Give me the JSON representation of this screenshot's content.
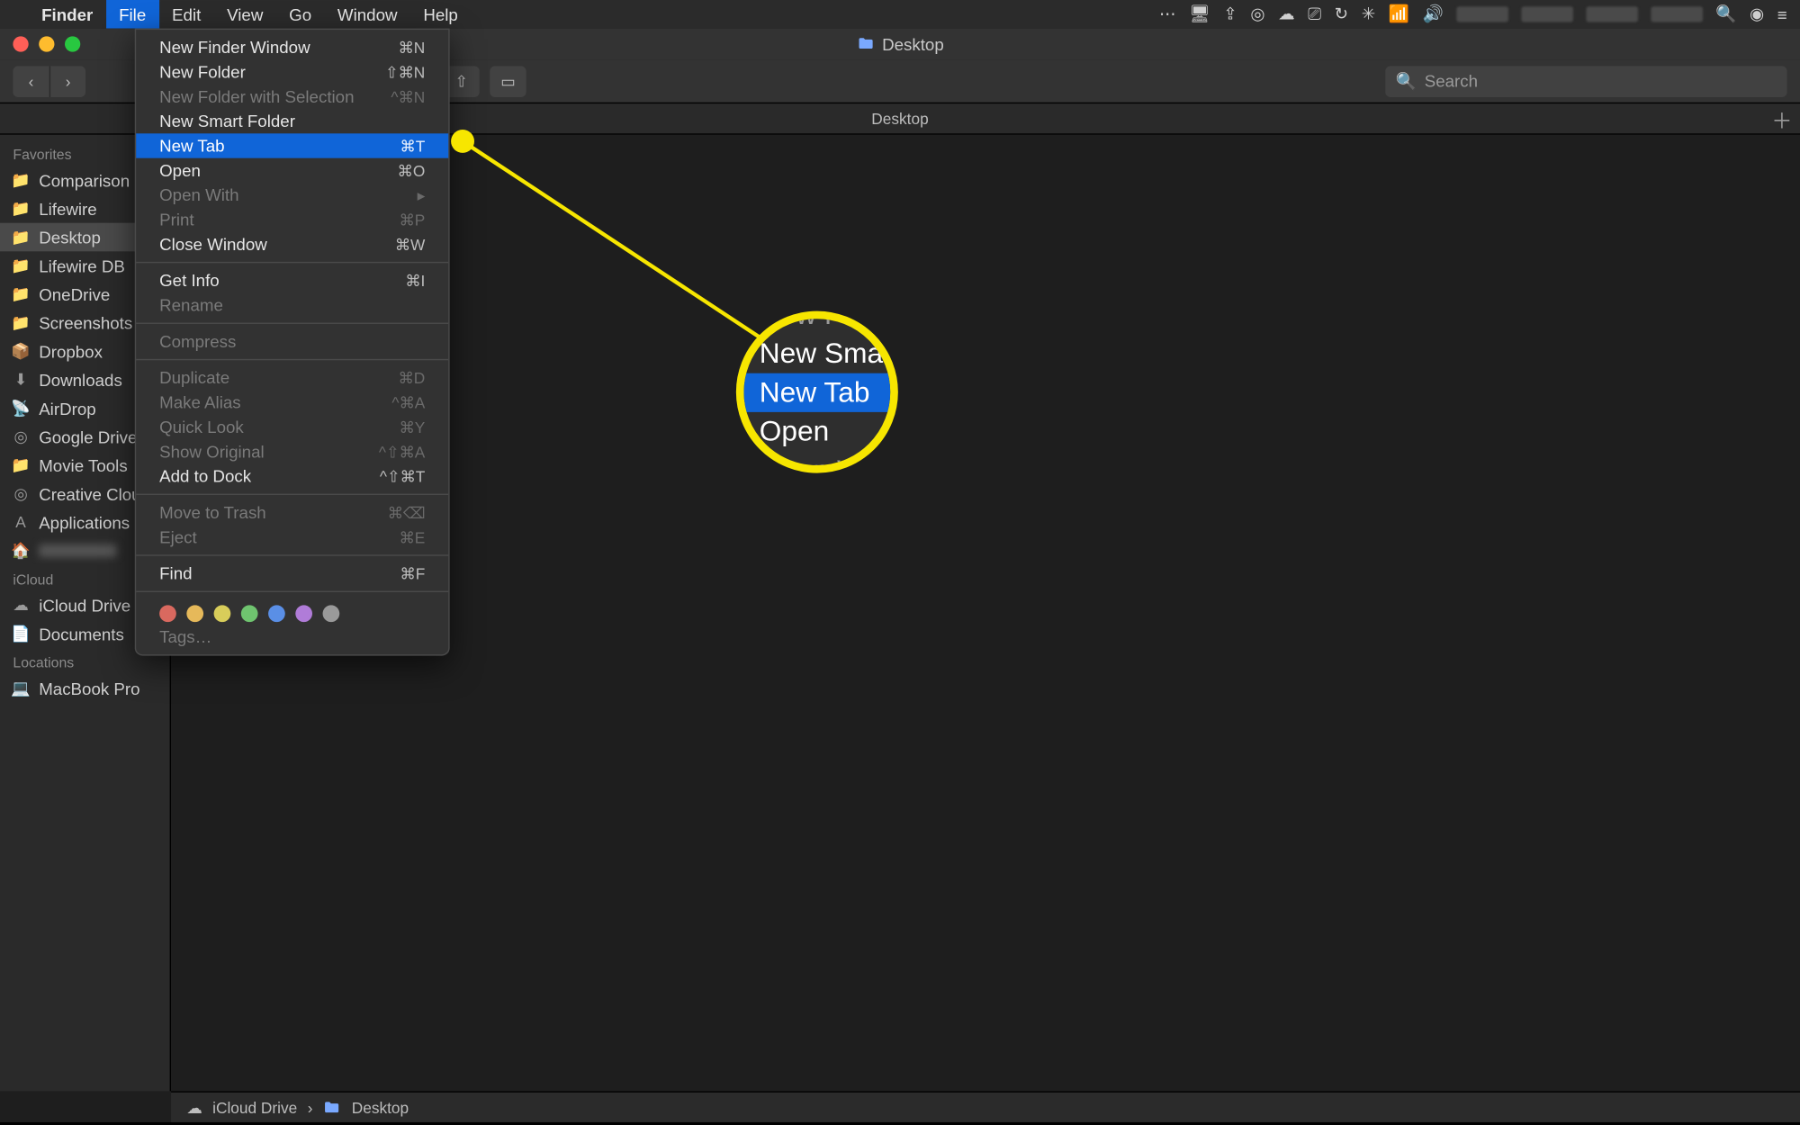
{
  "menubar": {
    "app": "Finder",
    "items": [
      "File",
      "Edit",
      "View",
      "Go",
      "Window",
      "Help"
    ],
    "active_index": 0
  },
  "window": {
    "title": "Desktop",
    "tab_title": "Desktop",
    "search_placeholder": "Search"
  },
  "toolbar": {
    "back": "‹",
    "forward": "›"
  },
  "sidebar": {
    "sections": [
      {
        "label": "Favorites",
        "items": [
          {
            "icon": "📁",
            "label": "Comparison"
          },
          {
            "icon": "📁",
            "label": "Lifewire"
          },
          {
            "icon": "📁",
            "label": "Desktop",
            "selected": true
          },
          {
            "icon": "📁",
            "label": "Lifewire DB"
          },
          {
            "icon": "📁",
            "label": "OneDrive"
          },
          {
            "icon": "📁",
            "label": "Screenshots"
          },
          {
            "icon": "📦",
            "label": "Dropbox"
          },
          {
            "icon": "⬇︎",
            "label": "Downloads"
          },
          {
            "icon": "📡",
            "label": "AirDrop"
          },
          {
            "icon": "◎",
            "label": "Google Drive"
          },
          {
            "icon": "📁",
            "label": "Movie Tools"
          },
          {
            "icon": "◎",
            "label": "Creative Cloud"
          },
          {
            "icon": "A",
            "label": "Applications"
          },
          {
            "icon": "🏠",
            "label": "",
            "blurred": true
          }
        ]
      },
      {
        "label": "iCloud",
        "items": [
          {
            "icon": "☁︎",
            "label": "iCloud Drive"
          },
          {
            "icon": "📄",
            "label": "Documents"
          }
        ]
      },
      {
        "label": "Locations",
        "items": [
          {
            "icon": "💻",
            "label": "MacBook Pro"
          }
        ]
      }
    ]
  },
  "file_menu": [
    {
      "label": "New Finder Window",
      "shortcut": "⌘N"
    },
    {
      "label": "New Folder",
      "shortcut": "⇧⌘N"
    },
    {
      "label": "New Folder with Selection",
      "shortcut": "^⌘N",
      "disabled": true
    },
    {
      "label": "New Smart Folder"
    },
    {
      "label": "New Tab",
      "shortcut": "⌘T",
      "highlight": true
    },
    {
      "label": "Open",
      "shortcut": "⌘O"
    },
    {
      "label": "Open With",
      "submenu": true,
      "disabled": true
    },
    {
      "label": "Print",
      "shortcut": "⌘P",
      "disabled": true
    },
    {
      "label": "Close Window",
      "shortcut": "⌘W"
    },
    {
      "sep": true
    },
    {
      "label": "Get Info",
      "shortcut": "⌘I"
    },
    {
      "label": "Rename",
      "disabled": true
    },
    {
      "sep": true
    },
    {
      "label": "Compress",
      "disabled": true
    },
    {
      "sep": true
    },
    {
      "label": "Duplicate",
      "shortcut": "⌘D",
      "disabled": true
    },
    {
      "label": "Make Alias",
      "shortcut": "^⌘A",
      "disabled": true
    },
    {
      "label": "Quick Look",
      "shortcut": "⌘Y",
      "disabled": true
    },
    {
      "label": "Show Original",
      "shortcut": "^⇧⌘A",
      "disabled": true
    },
    {
      "label": "Add to Dock",
      "shortcut": "^⇧⌘T"
    },
    {
      "sep": true
    },
    {
      "label": "Move to Trash",
      "shortcut": "⌘⌫",
      "disabled": true
    },
    {
      "label": "Eject",
      "shortcut": "⌘E",
      "disabled": true
    },
    {
      "sep": true
    },
    {
      "label": "Find",
      "shortcut": "⌘F"
    },
    {
      "sep": true
    },
    {
      "tags": [
        "#d9695f",
        "#e6b95a",
        "#d8cd5a",
        "#6fc46f",
        "#5a8fe6",
        "#b07cd8",
        "#9a9a9a"
      ]
    },
    {
      "label": "Tags…",
      "disabled": true
    }
  ],
  "pathbar": {
    "seg1": "iCloud Drive",
    "seg2": "Desktop"
  },
  "callout": {
    "rows": [
      {
        "text": "New Fol",
        "dim": true
      },
      {
        "text": "New Smar"
      },
      {
        "text": "New Tab",
        "hl": true
      },
      {
        "text": "Open"
      },
      {
        "text": "Open W",
        "dim": true
      }
    ]
  },
  "menubar_right_icons": [
    "⋯",
    "🖥",
    "⇪",
    "◎",
    "☁︎",
    "⎚",
    "↻",
    "✳︎",
    "📶",
    "🔊"
  ]
}
